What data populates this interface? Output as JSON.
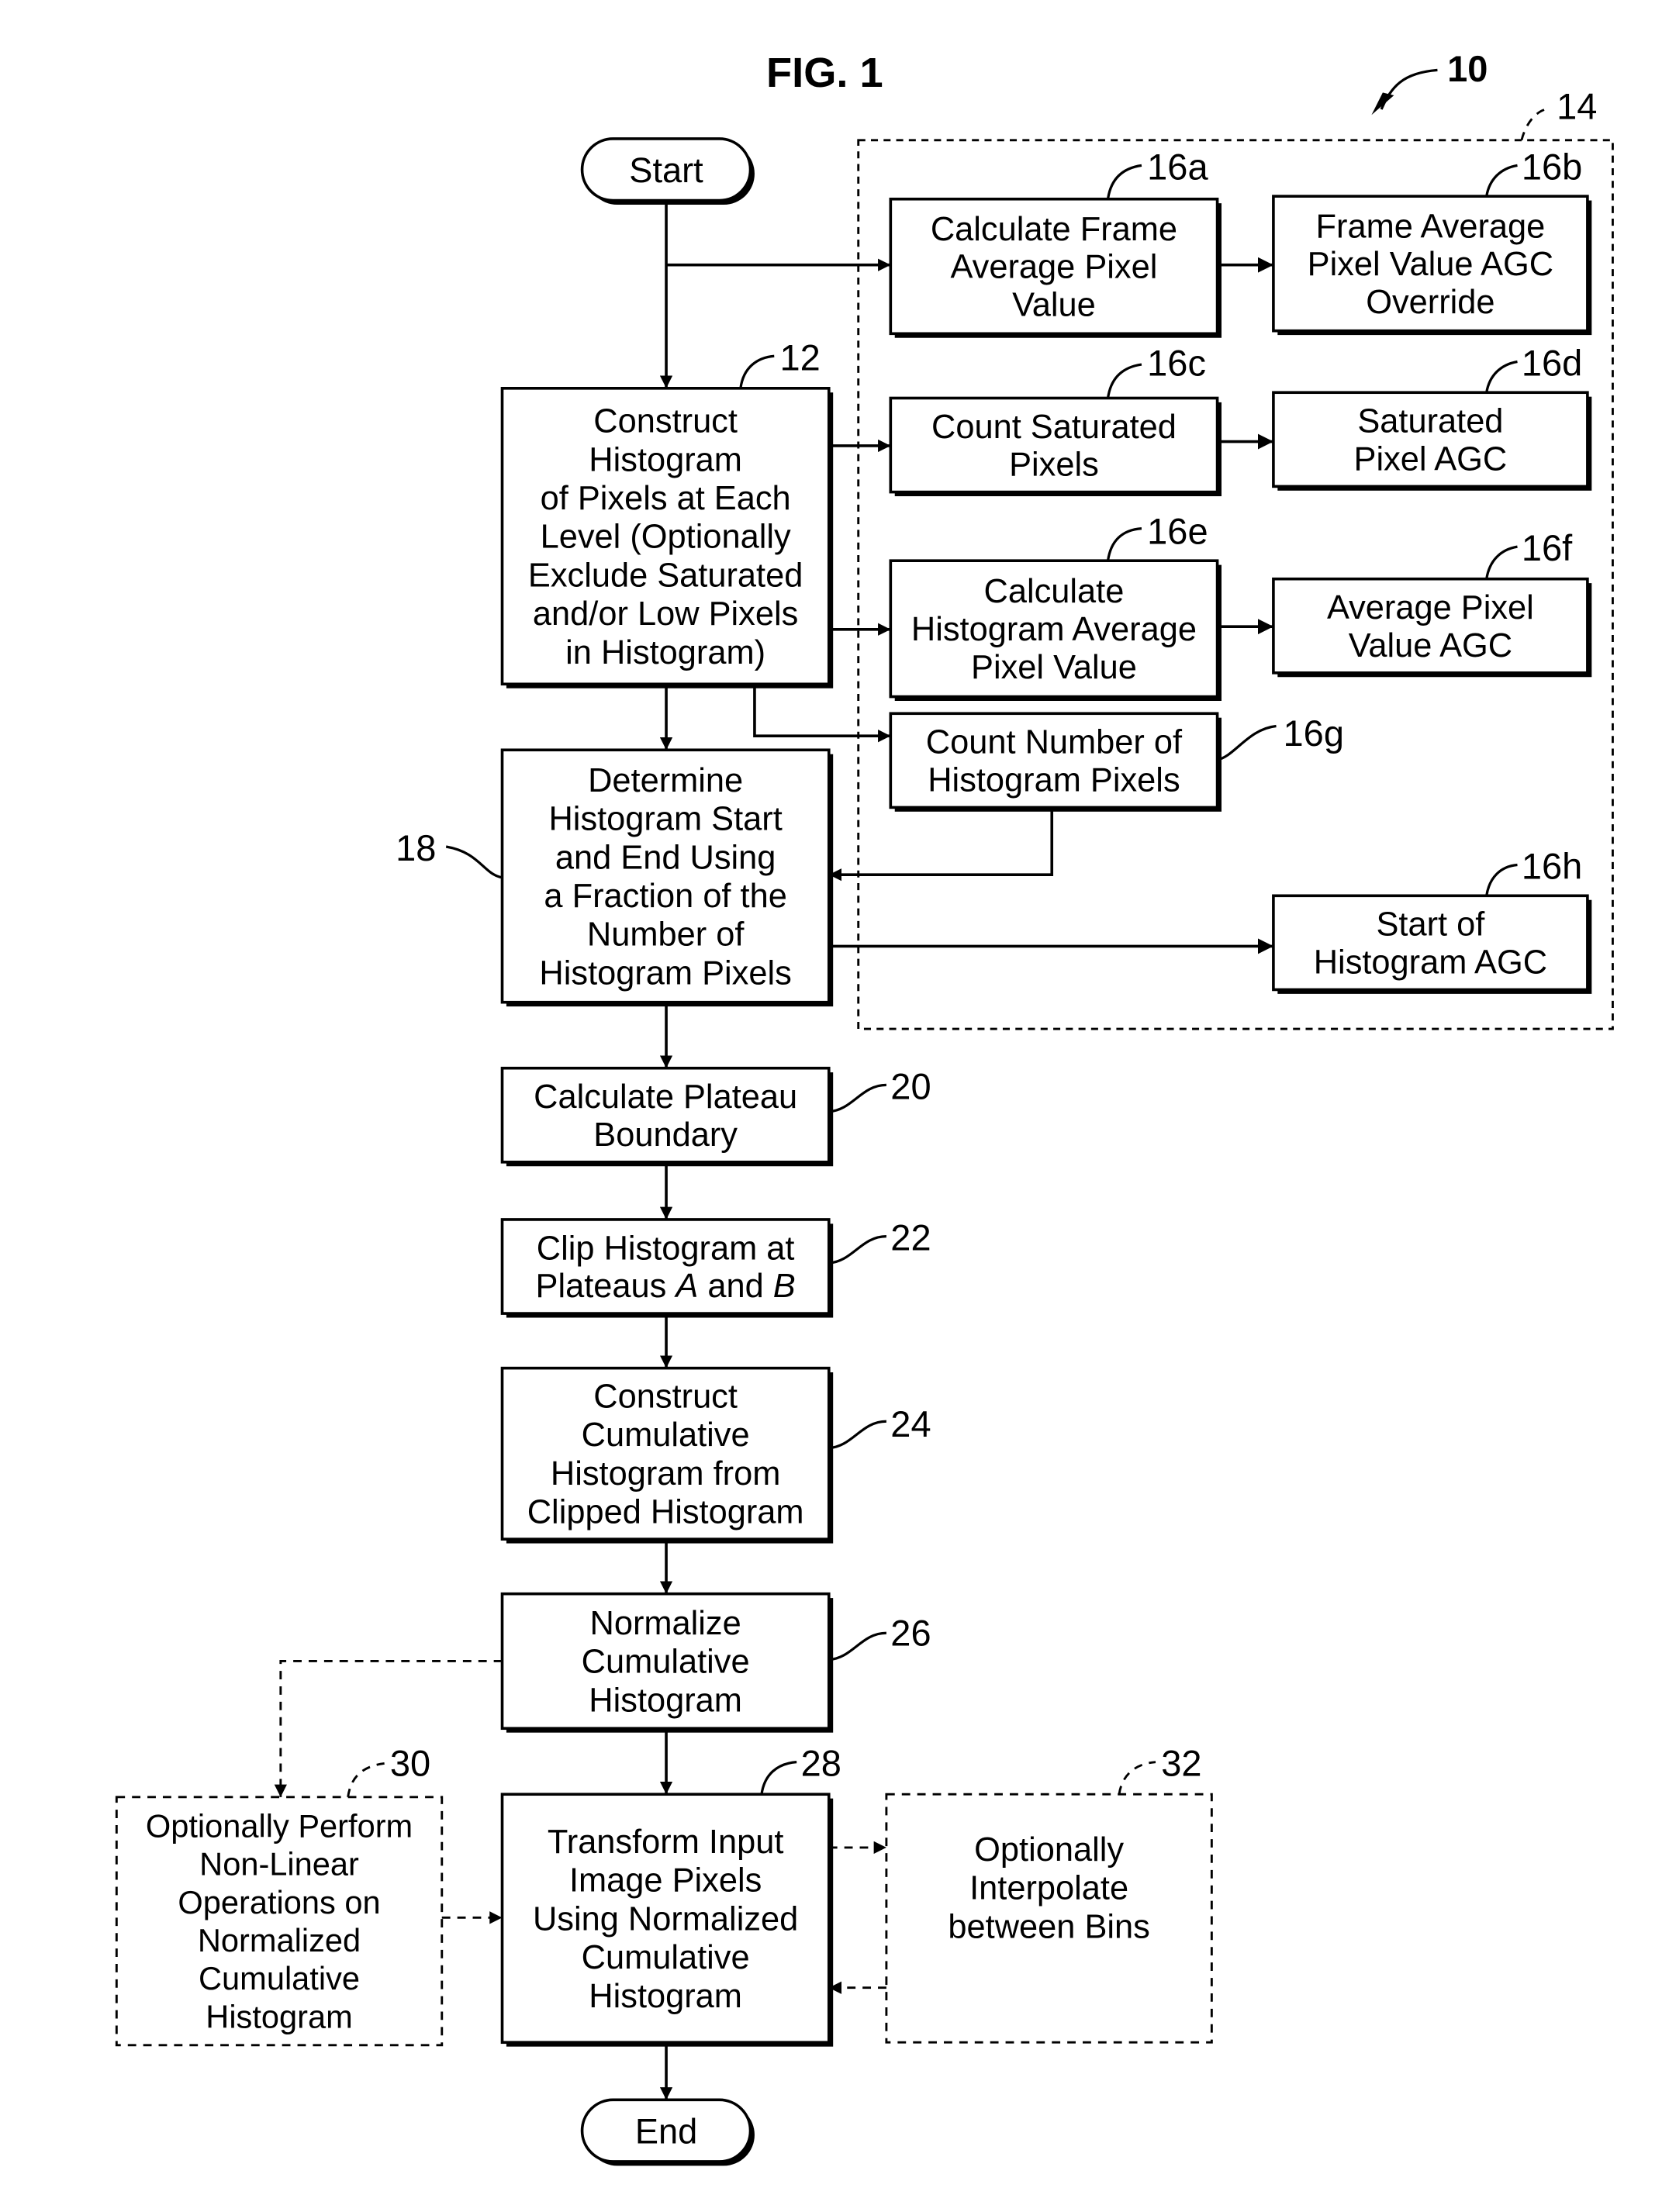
{
  "figure": {
    "title": "FIG. 1",
    "overall_ref": "10",
    "group_ref": "14"
  },
  "terminals": {
    "start": "Start",
    "end": "End"
  },
  "steps": {
    "s12": {
      "ref": "12",
      "lines": [
        "Construct",
        "Histogram",
        "of Pixels at Each",
        "Level (Optionally",
        "Exclude Saturated",
        "and/or Low Pixels",
        "in Histogram)"
      ]
    },
    "s16a": {
      "ref": "16a",
      "lines": [
        "Calculate Frame",
        "Average Pixel",
        "Value"
      ]
    },
    "s16b": {
      "ref": "16b",
      "lines": [
        "Frame Average",
        "Pixel Value AGC",
        "Override"
      ]
    },
    "s16c": {
      "ref": "16c",
      "lines": [
        "Count Saturated",
        "Pixels"
      ]
    },
    "s16d": {
      "ref": "16d",
      "lines": [
        "Saturated",
        "Pixel AGC"
      ]
    },
    "s16e": {
      "ref": "16e",
      "lines": [
        "Calculate",
        "Histogram Average",
        "Pixel Value"
      ]
    },
    "s16f": {
      "ref": "16f",
      "lines": [
        "Average Pixel",
        "Value AGC"
      ]
    },
    "s16g": {
      "ref": "16g",
      "lines": [
        "Count Number of",
        "Histogram Pixels"
      ]
    },
    "s16h": {
      "ref": "16h",
      "lines": [
        "Start of",
        "Histogram AGC"
      ]
    },
    "s18": {
      "ref": "18",
      "lines": [
        "Determine",
        "Histogram Start",
        "and End Using",
        "a Fraction of the",
        "Number of",
        "Histogram Pixels"
      ]
    },
    "s20": {
      "ref": "20",
      "lines": [
        "Calculate Plateau",
        "Boundary"
      ]
    },
    "s22": {
      "ref": "22",
      "lines": [
        "Clip Histogram at",
        "Plateaus A and B"
      ]
    },
    "s24": {
      "ref": "24",
      "lines": [
        "Construct",
        "Cumulative",
        "Histogram from",
        "Clipped Histogram"
      ]
    },
    "s26": {
      "ref": "26",
      "lines": [
        "Normalize",
        "Cumulative",
        "Histogram"
      ]
    },
    "s28": {
      "ref": "28",
      "lines": [
        "Transform Input",
        "Image Pixels",
        "Using Normalized",
        "Cumulative",
        "Histogram"
      ]
    },
    "s30": {
      "ref": "30",
      "optional": true,
      "lines": [
        "Optionally Perform",
        "Non-Linear",
        "Operations on",
        "Normalized",
        "Cumulative",
        "Histogram"
      ]
    },
    "s32": {
      "ref": "32",
      "optional": true,
      "lines": [
        "Optionally",
        "Interpolate",
        "between Bins"
      ]
    }
  }
}
